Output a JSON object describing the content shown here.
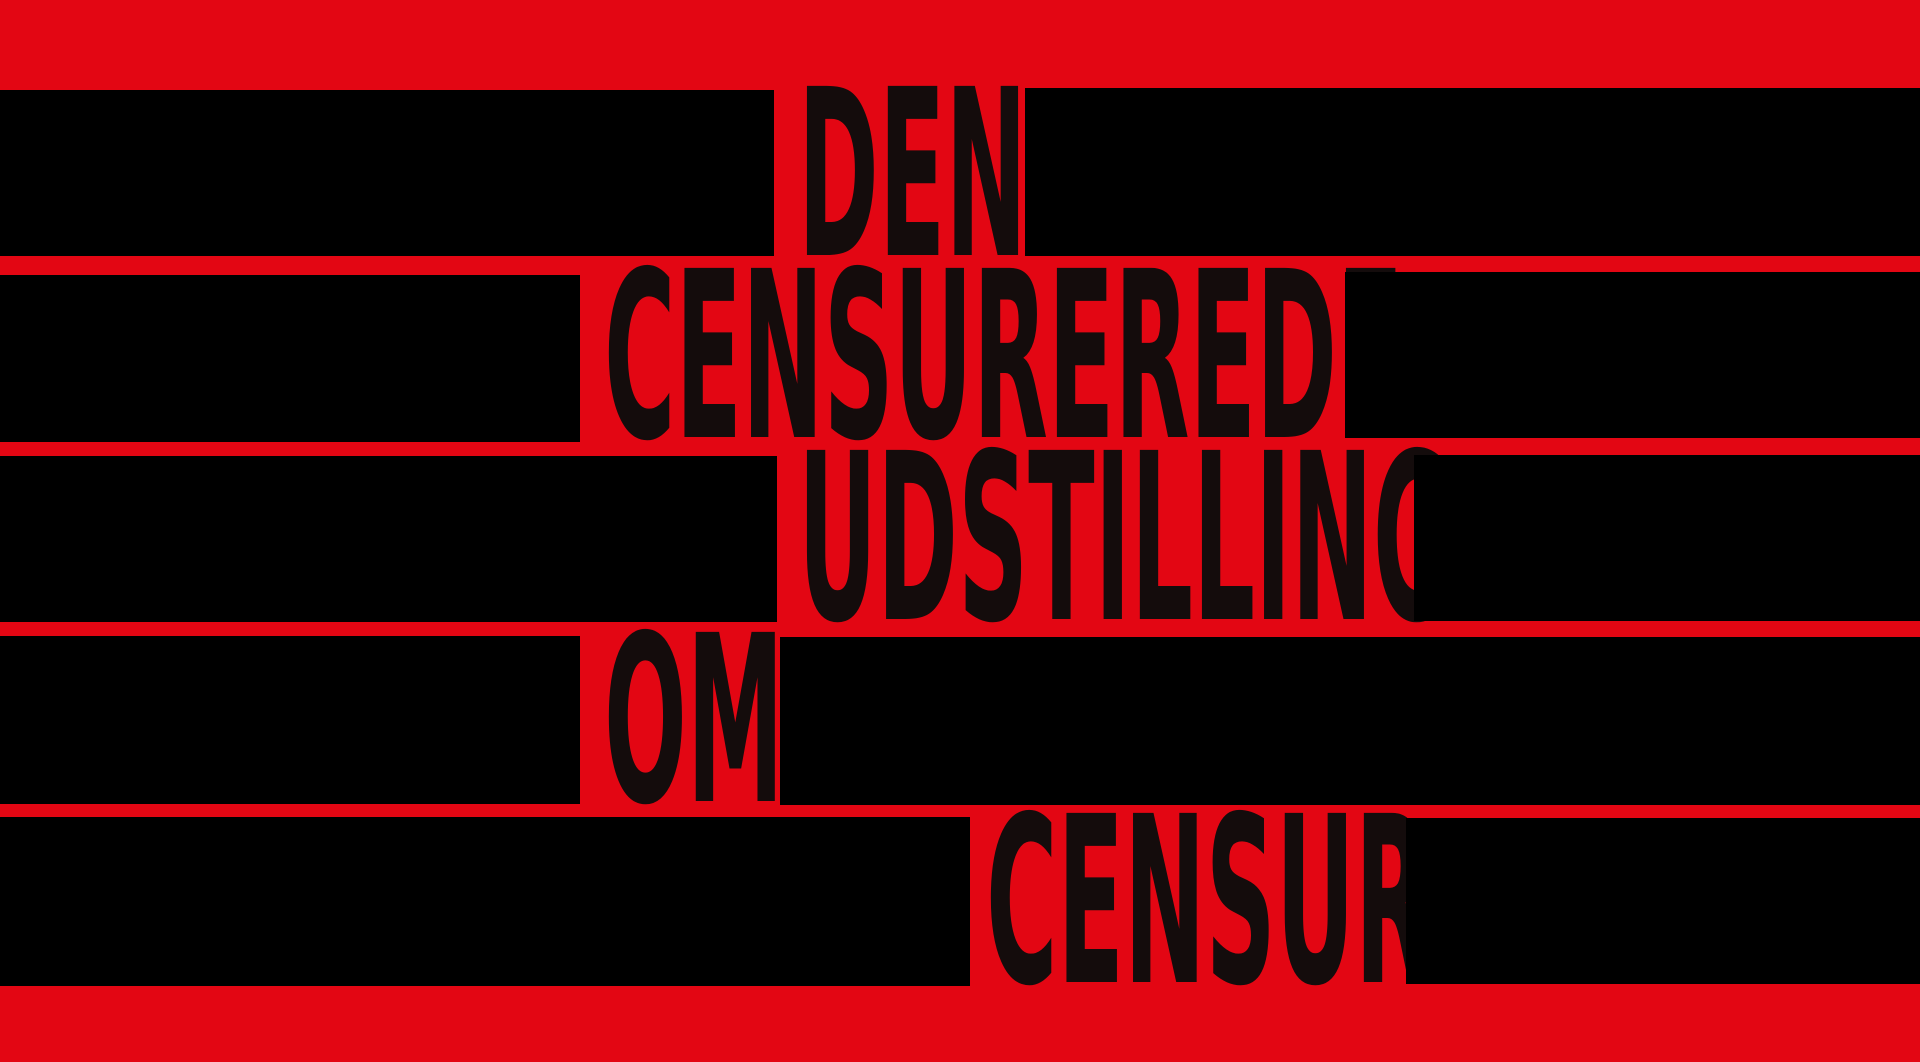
{
  "colors": {
    "background": "#e30613",
    "bar": "#000000",
    "ink": "#140c0c"
  },
  "lines": [
    {
      "word": "DEN"
    },
    {
      "word": "CENSUREREDE"
    },
    {
      "word": "UDSTILLING"
    },
    {
      "word": "OM"
    },
    {
      "word": "CENSUR"
    }
  ]
}
